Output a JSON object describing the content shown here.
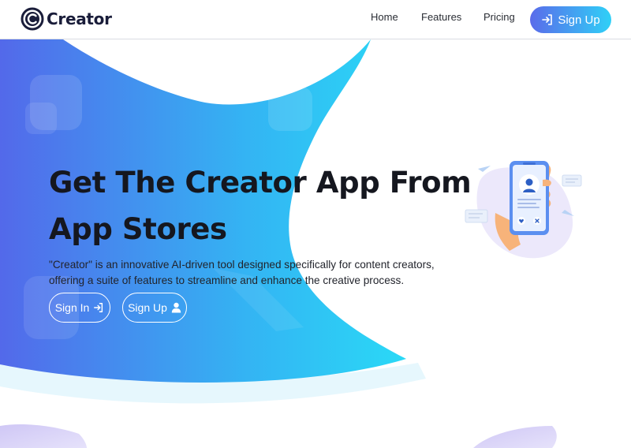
{
  "brand": {
    "name": "Creator",
    "logo_icon": "creator-c-logo"
  },
  "nav": {
    "links": [
      {
        "label": "Home"
      },
      {
        "label": "Features"
      },
      {
        "label": "Pricing"
      }
    ],
    "signup_label": "Sign Up",
    "signup_icon": "sign-in-arrow-icon"
  },
  "hero": {
    "title": "Get The Creator App From App Stores",
    "description": "\"Creator\" is an innovative AI-driven tool designed specifically for content creators, offering a suite of features to streamline and enhance the creative process.",
    "signin_label": "Sign In",
    "signin_icon": "sign-in-arrow-icon",
    "signup_label": "Sign Up",
    "signup_icon": "user-icon"
  },
  "colors": {
    "gradient_start": "#5a6bea",
    "gradient_end": "#2fd0f7",
    "title_text": "#15171f",
    "brand_text": "#1a1d3a",
    "illustration_phone": "#5b8ff0",
    "illustration_hand": "#f7b37a",
    "illustration_blob": "#ece8fb"
  }
}
